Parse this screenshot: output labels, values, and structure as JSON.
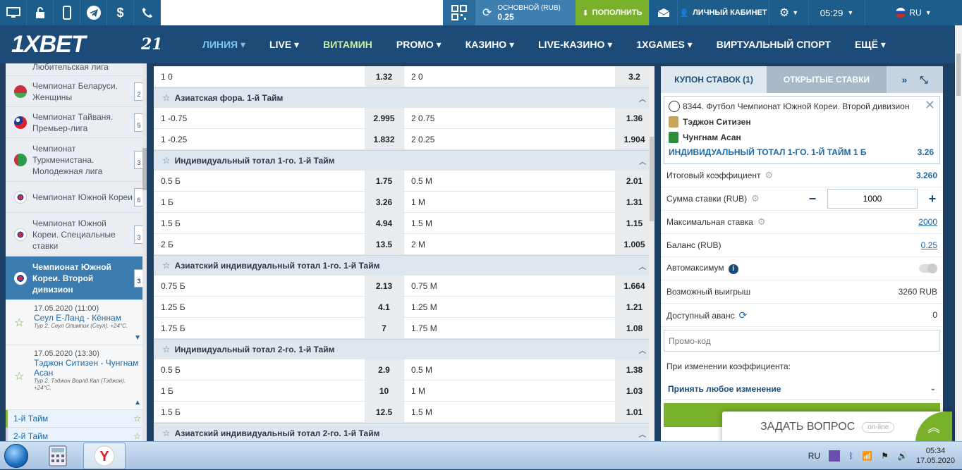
{
  "topbar": {
    "account_label": "ОСНОВНОЙ (RUB)",
    "account_balance": "0.25",
    "deposit_label": "ПОПОЛНИТЬ",
    "cabinet_label": "ЛИЧНЫЙ КАБИНЕТ",
    "time": "05:29",
    "lang": "RU"
  },
  "nav": {
    "logo": "1XBET",
    "twentyone": "21",
    "items": [
      "ЛИНИЯ",
      "LIVE",
      "ВИТАМИН",
      "PROMO",
      "КАЗИНО",
      "LIVE-КАЗИНО",
      "1XGAMES",
      "ВИРТУАЛЬНЫЙ СПОРТ",
      "ЕЩЁ"
    ]
  },
  "sidebar": {
    "leagues": [
      {
        "name": "Любительская лига",
        "count": ""
      },
      {
        "name": "Чемпионат Беларуси. Женщины",
        "count": "2"
      },
      {
        "name": "Чемпионат Тайваня. Премьер-лига",
        "count": "5"
      },
      {
        "name": "Чемпионат Туркменистана. Молодежная лига",
        "count": "3"
      },
      {
        "name": "Чемпионат Южной Кореи",
        "count": "6"
      },
      {
        "name": "Чемпионат Южной Кореи. Специальные ставки",
        "count": "3"
      },
      {
        "name": "Чемпионат Южной Кореи. Второй дивизион",
        "count": "3"
      }
    ],
    "matches": [
      {
        "date": "17.05.2020 (11:00)",
        "teams": "Сеул Е-Ланд - Кённам",
        "info": "Тур 2. Сеул Олимпик (Сеул). +24°C."
      },
      {
        "date": "17.05.2020 (13:30)",
        "teams": "Тэджон Ситизен - Чунгнам Асан",
        "info": "Тур 2. Тэджон Ворлд Кап (Тэджон). +24°C."
      }
    ],
    "periods": [
      "1-й Тайм",
      "2-й Тайм"
    ]
  },
  "markets": {
    "top_row": {
      "left_name": "1 0",
      "left_odd": "1.32",
      "right_name": "2 0",
      "right_odd": "3.2"
    },
    "groups": [
      {
        "title": "Азиатская фора. 1-й Тайм",
        "rows": [
          {
            "left_name": "1 -0.75",
            "left_odd": "2.995",
            "right_name": "2 0.75",
            "right_odd": "1.36"
          },
          {
            "left_name": "1 -0.25",
            "left_odd": "1.832",
            "right_name": "2 0.25",
            "right_odd": "1.904"
          }
        ]
      },
      {
        "title": "Индивидуальный тотал 1-го. 1-й Тайм",
        "rows": [
          {
            "left_name": "0.5 Б",
            "left_odd": "1.75",
            "right_name": "0.5 М",
            "right_odd": "2.01"
          },
          {
            "left_name": "1 Б",
            "left_odd": "3.26",
            "right_name": "1 М",
            "right_odd": "1.31"
          },
          {
            "left_name": "1.5 Б",
            "left_odd": "4.94",
            "right_name": "1.5 М",
            "right_odd": "1.15"
          },
          {
            "left_name": "2 Б",
            "left_odd": "13.5",
            "right_name": "2 М",
            "right_odd": "1.005"
          }
        ]
      },
      {
        "title": "Азиатский индивидуальный тотал 1-го. 1-й Тайм",
        "rows": [
          {
            "left_name": "0.75 Б",
            "left_odd": "2.13",
            "right_name": "0.75 М",
            "right_odd": "1.664"
          },
          {
            "left_name": "1.25 Б",
            "left_odd": "4.1",
            "right_name": "1.25 М",
            "right_odd": "1.21"
          },
          {
            "left_name": "1.75 Б",
            "left_odd": "7",
            "right_name": "1.75 М",
            "right_odd": "1.08"
          }
        ]
      },
      {
        "title": "Индивидуальный тотал 2-го. 1-й Тайм",
        "rows": [
          {
            "left_name": "0.5 Б",
            "left_odd": "2.9",
            "right_name": "0.5 М",
            "right_odd": "1.38"
          },
          {
            "left_name": "1 Б",
            "left_odd": "10",
            "right_name": "1 М",
            "right_odd": "1.03"
          },
          {
            "left_name": "1.5 Б",
            "left_odd": "12.5",
            "right_name": "1.5 М",
            "right_odd": "1.01"
          }
        ]
      },
      {
        "title": "Азиатский индивидуальный тотал 2-го. 1-й Тайм",
        "rows": []
      }
    ]
  },
  "coupon": {
    "tab_coupon": "КУПОН СТАВОК (1)",
    "tab_open": "ОТКРЫТЫЕ СТАВКИ",
    "league": "8344. Футбол Чемпионат Южной Кореи. Второй дивизион",
    "team1": "Тэджон Ситизен",
    "team2": "Чунгнам Асан",
    "market": "ИНДИВИДУАЛЬНЫЙ ТОТАЛ 1-ГО. 1-Й ТАЙМ 1 Б",
    "market_odd": "3.26",
    "total_coef_label": "Итоговый коэффициент",
    "total_coef": "3.260",
    "stake_label": "Сумма ставки (RUB)",
    "stake_value": "1000",
    "max_stake_label": "Максимальная ставка",
    "max_stake": "2000",
    "balance_label": "Баланс (RUB)",
    "balance": "0.25",
    "automax_label": "Автомаксимум",
    "win_label": "Возможный выигрыш",
    "win": "3260 RUB",
    "advance_label": "Доступный аванс",
    "advance": "0",
    "promo_placeholder": "Промо-код",
    "change_label": "При изменении коэффициента:",
    "accept_label": "Принять любое изменение"
  },
  "chat": {
    "label": "ЗАДАТЬ ВОПРОС",
    "status": "on-line"
  },
  "taskbar": {
    "lang": "RU",
    "time": "05:34",
    "date": "17.05.2020"
  }
}
